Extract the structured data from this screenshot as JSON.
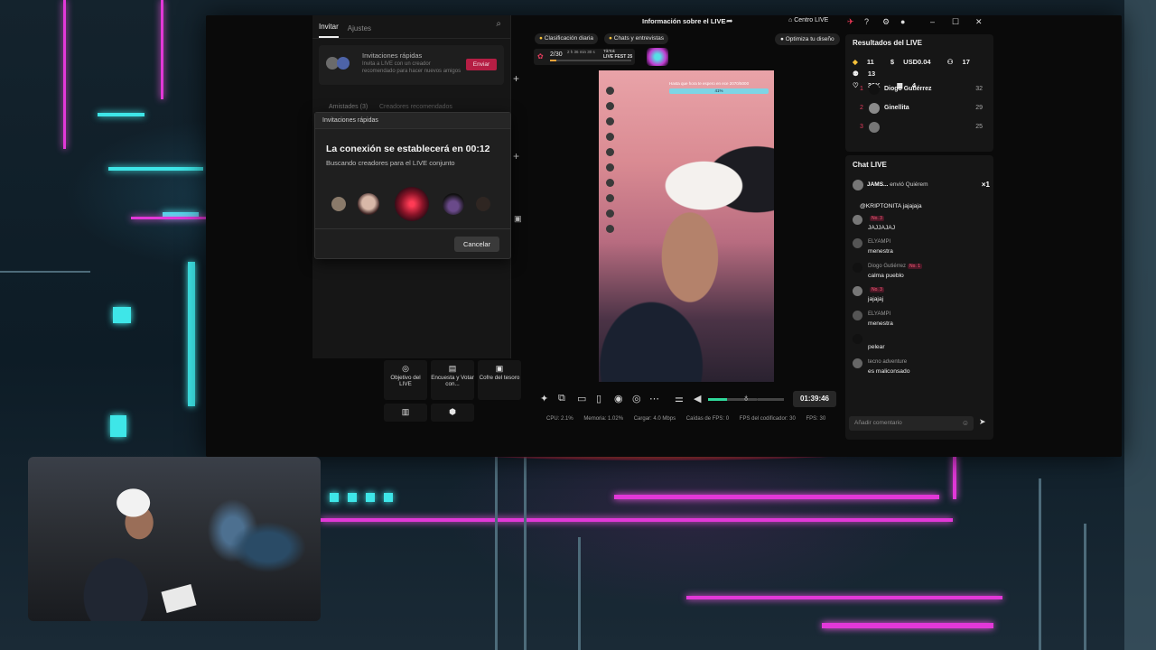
{
  "window": {
    "title": "Información sobre el LIVE",
    "centro": "Centro LIVE"
  },
  "left_panel": {
    "tabs": [
      "Invitar",
      "Ajustes"
    ],
    "quick_title": "Invitaciones rápidas",
    "quick_desc": "Invita a LIVE con un creador recomendado para hacer nuevos amigos",
    "send_label": "Enviar",
    "sub_tabs": [
      "Amistades (3)",
      "Creadores recomendados"
    ]
  },
  "modal": {
    "header": "Invitaciones rápidas",
    "title": "La conexión se establecerá en 00:12",
    "subtitle": "Buscando creadores para el LIVE conjunto",
    "cancel": "Cancelar"
  },
  "tools": [
    {
      "label": "Objetivo del LIVE",
      "icon": "target-icon"
    },
    {
      "label": "Encuesta y Votar con...",
      "icon": "poll-icon"
    },
    {
      "label": "Cofre del tesoro",
      "icon": "chest-icon"
    },
    {
      "label": "",
      "icon": "box-icon"
    },
    {
      "label": "",
      "icon": "hexagon-icon"
    }
  ],
  "center": {
    "pill_rank": "Clasificación diaria",
    "pill_chats": "Chats y entrevistas",
    "optimize": "Optimiza tu diseño",
    "rank_value": "2/30",
    "rank_time": "2 h 36 min 30 s",
    "fest_brand": "TikTok",
    "fest_name": "LIVE FEST 25",
    "video_goal_text": "Hasta que hora te espero en ece 2070/5000",
    "video_goal_pct": "41%",
    "timer": "01:39:46",
    "volume_level": 0.38
  },
  "stats": [
    "CPU: 2.1%",
    "Memoria: 1.02%",
    "Cargar: 4.0 Mbps",
    "Caídas de FPS: 0",
    "FPS del codificador: 30",
    "FPS: 30"
  ],
  "results": {
    "title": "Resultados del LIVE",
    "diamonds": "11",
    "usd": "USD0.04",
    "viewers": "17",
    "new": "13",
    "likes": "39K",
    "gifts": "4",
    "leaderboard": [
      {
        "rank": "1",
        "name": "Diogo Gutiérrez",
        "score": "32"
      },
      {
        "rank": "2",
        "name": "Ginellita",
        "score": "29"
      },
      {
        "rank": "3",
        "name": "",
        "score": "25"
      }
    ]
  },
  "chat": {
    "title": "Chat LIVE",
    "gift_user": "JAMS...",
    "gift_text": "envió Quiérem",
    "gift_count": "×1",
    "messages": [
      {
        "user": "",
        "text": "@KRIPTONITA jajajaja",
        "badge": ""
      },
      {
        "user": "",
        "text": "JAJJAJAJ",
        "badge": "No. 3"
      },
      {
        "user": "ELYAMPI",
        "text": "menestra",
        "badge": ""
      },
      {
        "user": "Diogo Gutiérrez",
        "text": "calma pueblo",
        "badge": "No. 1"
      },
      {
        "user": "",
        "text": "jajajaj",
        "badge": "No. 3"
      },
      {
        "user": "ELYAMPI",
        "text": "menestra",
        "badge": ""
      },
      {
        "user": "",
        "text": "pelear",
        "badge": ""
      },
      {
        "user": "tecno adventure",
        "text": "es maliconsado",
        "badge": ""
      }
    ],
    "placeholder": "Añadir comentario"
  }
}
